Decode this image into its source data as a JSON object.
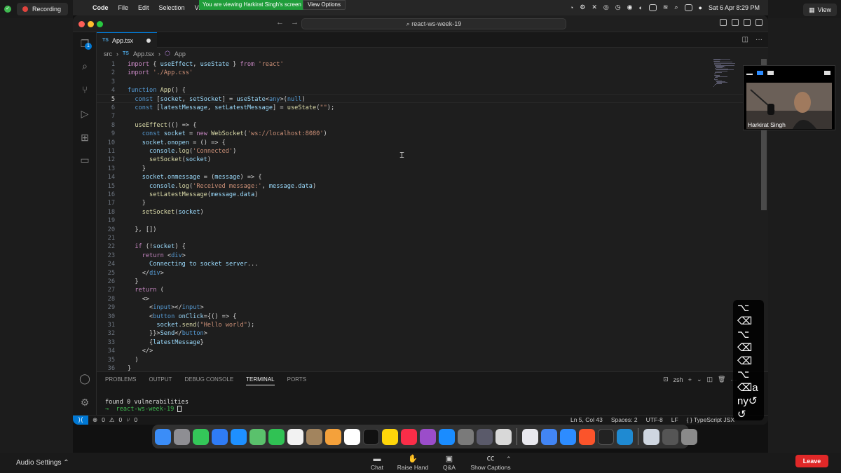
{
  "zoom": {
    "recording_label": "Recording",
    "view_label": "View",
    "banner": "You are viewing Harkirat Singh's screen",
    "view_options": "View Options",
    "audio_settings": "Audio Settings",
    "chat": "Chat",
    "raise_hand": "Raise Hand",
    "qa": "Q&A",
    "captions": "Show Captions",
    "leave": "Leave",
    "participant_name": "Harkirat Singh"
  },
  "menubar": {
    "apple": "",
    "app": "Code",
    "items": [
      "File",
      "Edit",
      "Selection",
      "View"
    ],
    "datetime": "Sat 6 Apr  8:29 PM"
  },
  "vscode": {
    "search": "react-ws-week-19",
    "tab_name": "App.tsx",
    "tab_lang": "TS",
    "explorer_badge": "1",
    "breadcrumb": [
      "src",
      "App.tsx",
      "App"
    ],
    "code_lines": [
      "import { useEffect, useState } from 'react'",
      "import './App.css'",
      "",
      "function App() {",
      "  const [socket, setSocket] = useState<any>(null)",
      "  const [latestMessage, setLatestMessage] = useState(\"\");",
      "",
      "  useEffect(() => {",
      "    const socket = new WebSocket('ws://localhost:8080')",
      "    socket.onopen = () => {",
      "      console.log('Connected')",
      "      setSocket(socket)",
      "    }",
      "    socket.onmessage = (message) => {",
      "      console.log('Received message:', message.data)",
      "      setLatestMessage(message.data)",
      "    }",
      "    setSocket(socket)",
      "",
      "  }, [])",
      "",
      "  if (!socket) {",
      "    return <div>",
      "      Connecting to socket server...",
      "    </div>",
      "  }",
      "  return (",
      "    <>",
      "      <input></input>",
      "      <button onClick={() => {",
      "        socket.send(\"Hello world\");",
      "      }}>Send</button>",
      "      {latestMessage}",
      "    </>",
      "  )",
      "}"
    ],
    "current_line": 5,
    "panel_tabs": [
      "PROBLEMS",
      "OUTPUT",
      "DEBUG CONSOLE",
      "TERMINAL",
      "PORTS"
    ],
    "active_panel_tab": "TERMINAL",
    "shell": "zsh",
    "terminal_lines": [
      "found 0 vulnerabilities",
      "→  react-ws-week-19 "
    ],
    "status": {
      "errors": "0",
      "warnings": "0",
      "ports": "0",
      "position": "Ln 5, Col 43",
      "spaces": "Spaces: 2",
      "encoding": "UTF-8",
      "eol": "LF",
      "language": "TypeScript JSX"
    }
  },
  "keystrokes": [
    "⌥",
    "⌫",
    "⌥",
    "⌫",
    "⌫",
    "⌥",
    "⌫a",
    "ny↺",
    "↺"
  ]
}
